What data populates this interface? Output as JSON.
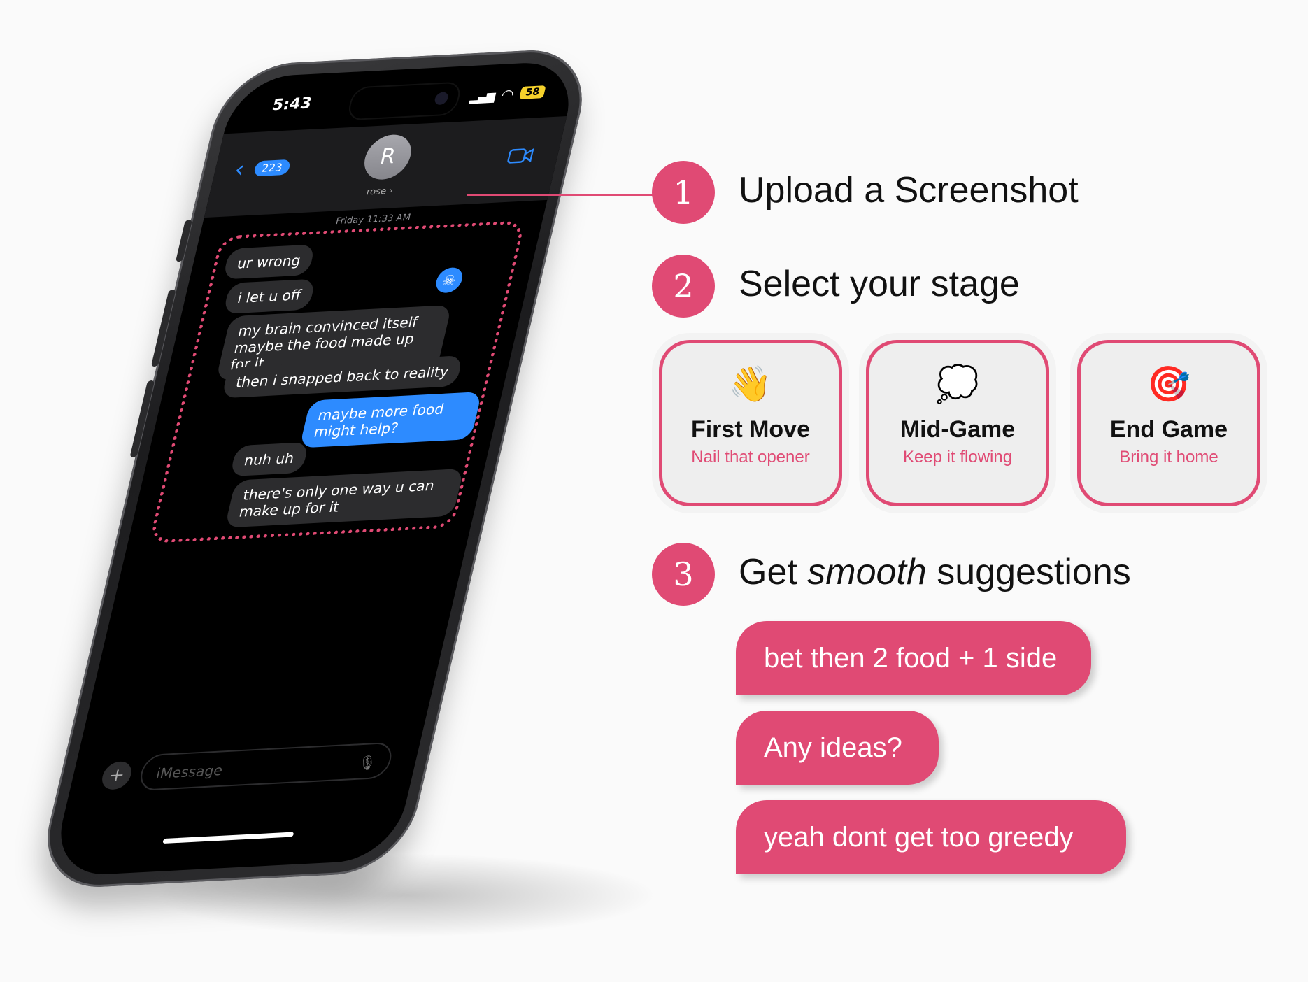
{
  "phone": {
    "status": {
      "time": "5:43",
      "battery": "58"
    },
    "header": {
      "back_count": "223",
      "avatar_initial": "R",
      "contact_name": "rose ›"
    },
    "timestamp": "Friday 11:33 AM",
    "messages": [
      {
        "text": "ur wrong",
        "dir": "in"
      },
      {
        "text": "i let u off",
        "dir": "in"
      },
      {
        "text": "my brain convinced itself maybe the food made up for it",
        "dir": "in"
      },
      {
        "text": "then i snapped back to reality",
        "dir": "in"
      },
      {
        "text": "maybe more food might help?",
        "dir": "out"
      },
      {
        "text": "nuh uh",
        "dir": "in"
      },
      {
        "text": "there's only one way u can make up for it",
        "dir": "in"
      }
    ],
    "reaction_icon": "skull-icon",
    "input_placeholder": "iMessage"
  },
  "steps": [
    {
      "number": "1",
      "title": "Upload a Screenshot"
    },
    {
      "number": "2",
      "title": "Select your stage"
    },
    {
      "number": "3",
      "title_prefix": "Get ",
      "title_emphasis": "smooth",
      "title_suffix": " suggestions"
    }
  ],
  "stages": [
    {
      "icon": "waving-hand-icon",
      "title": "First Move",
      "subtitle": "Nail that opener"
    },
    {
      "icon": "thought-bubble-icon",
      "title": "Mid-Game",
      "subtitle": "Keep it flowing"
    },
    {
      "icon": "target-icon",
      "title": "End Game",
      "subtitle": "Bring it home"
    }
  ],
  "suggestions": [
    "bet then 2 food + 1 side",
    "Any ideas?",
    "yeah dont get too greedy"
  ],
  "colors": {
    "accent": "#e04a74",
    "imessage_blue": "#2d8bff"
  }
}
